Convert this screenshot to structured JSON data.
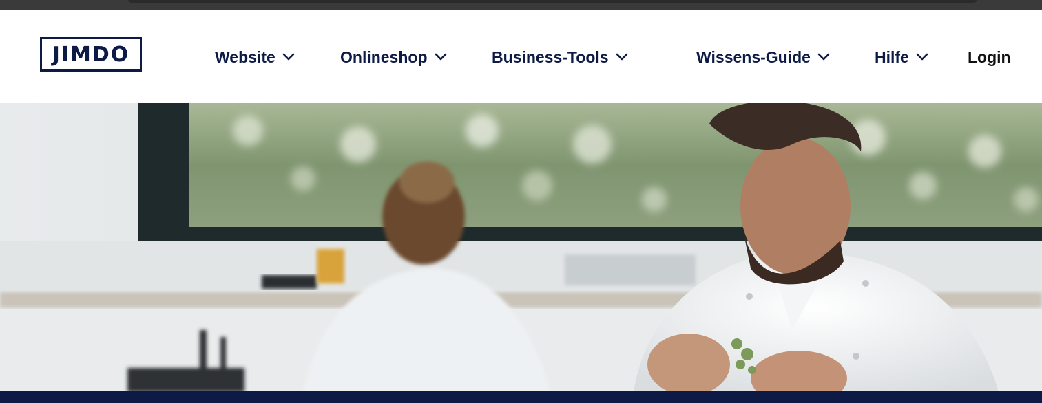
{
  "brand": {
    "logo_text": "JIMDO",
    "navy": "#0d1a45"
  },
  "nav": {
    "items": [
      {
        "label": "Website",
        "icon": "chevron-down-icon"
      },
      {
        "label": "Onlineshop",
        "icon": "chevron-down-icon"
      },
      {
        "label": "Business-Tools",
        "icon": "chevron-down-icon"
      },
      {
        "label": "Wissens-Guide",
        "icon": "chevron-down-icon"
      },
      {
        "label": "Hilfe",
        "icon": "chevron-down-icon"
      }
    ],
    "login_label": "Login"
  },
  "hero": {
    "image": "chef-in-kitchen-photo"
  }
}
